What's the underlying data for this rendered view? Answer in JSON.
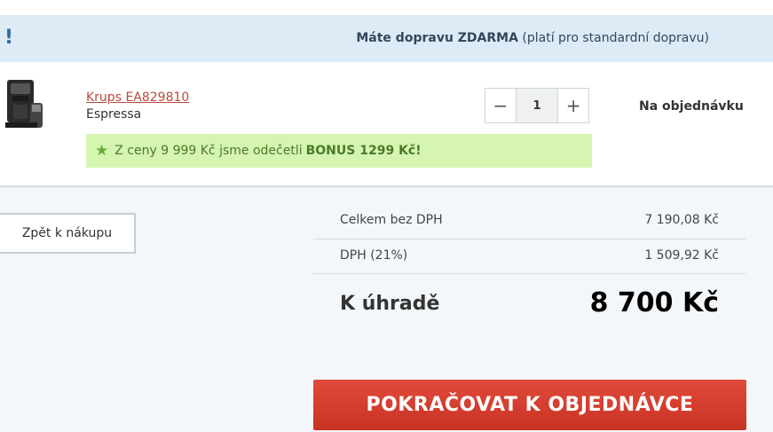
{
  "banner": {
    "icon": "exclamation-icon",
    "icon_glyph": "!",
    "bold_text": "Máte dopravu ZDARMA",
    "extra_text": "(platí pro standardní dopravu)"
  },
  "product": {
    "image": "coffee-machine-image",
    "name": "Krups EA829810",
    "category": "Espressa",
    "quantity": "1",
    "minus_icon": "minus-icon",
    "plus_icon": "plus-icon",
    "minus_glyph": "−",
    "plus_glyph": "+",
    "availability": "Na objednávku"
  },
  "bonus": {
    "icon": "star-icon",
    "icon_glyph": "★",
    "text": "Z ceny 9 999 Kč jsme odečetli",
    "bold": "BONUS 1299 Kč!"
  },
  "summary": {
    "back_label": "Zpět k nákupu",
    "rows": [
      {
        "label": "Celkem bez DPH",
        "value": "7 190,08 Kč"
      },
      {
        "label": "DPH (21%)",
        "value": "1 509,92 Kč"
      }
    ],
    "total_label": "K úhradě",
    "total_value": "8 700 Kč",
    "cta_label": "POKRAČOVAT K OBJEDNÁVCE"
  },
  "colors": {
    "banner_bg": "#dcebf6",
    "bonus_bg": "#d6f5b1",
    "cta": "#d43d2d",
    "link": "#b94a3c"
  }
}
